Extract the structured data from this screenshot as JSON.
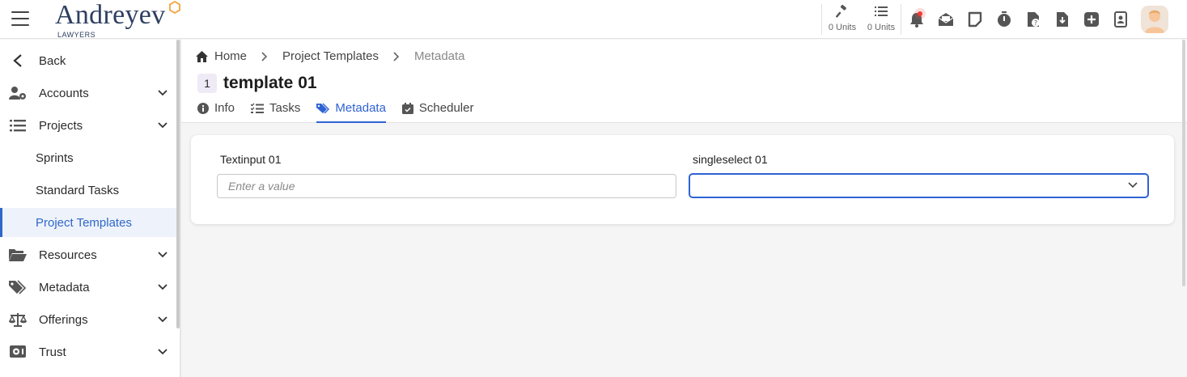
{
  "brand": {
    "name": "Andreyev",
    "tagline": "LAWYERS",
    "accent": "#f4a23a"
  },
  "topbar": {
    "units": [
      {
        "icon": "gavel-icon",
        "label": "0 Units"
      },
      {
        "icon": "list-icon",
        "label": "0 Units"
      }
    ],
    "icons": [
      "bell-icon",
      "mail-open-icon",
      "sticky-note-icon",
      "stopwatch-icon",
      "file-question-icon",
      "file-download-icon",
      "plus-square-icon",
      "contact-card-icon",
      "user-avatar"
    ]
  },
  "sidebar": {
    "items": [
      {
        "label": "Back",
        "icon": "chevron-left-icon",
        "expandable": false
      },
      {
        "label": "Accounts",
        "icon": "user-gear-icon",
        "expandable": true
      },
      {
        "label": "Projects",
        "icon": "list-icon",
        "expandable": true
      },
      {
        "label": "Sprints",
        "sub": true
      },
      {
        "label": "Standard Tasks",
        "sub": true
      },
      {
        "label": "Project Templates",
        "sub": true,
        "active": true
      },
      {
        "label": "Resources",
        "icon": "folder-open-icon",
        "expandable": true
      },
      {
        "label": "Metadata",
        "icon": "tags-icon",
        "expandable": true
      },
      {
        "label": "Offerings",
        "icon": "scale-icon",
        "expandable": true
      },
      {
        "label": "Trust",
        "icon": "vault-icon",
        "expandable": true
      }
    ]
  },
  "breadcrumb": {
    "home": "Home",
    "section": "Project Templates",
    "current": "Metadata"
  },
  "page": {
    "badge": "1",
    "title": "template 01"
  },
  "tabs": [
    {
      "label": "Info",
      "icon": "info-circle-icon"
    },
    {
      "label": "Tasks",
      "icon": "task-list-icon"
    },
    {
      "label": "Metadata",
      "icon": "tags-icon",
      "active": true
    },
    {
      "label": "Scheduler",
      "icon": "calendar-check-icon"
    }
  ],
  "form": {
    "text_label": "Textinput 01",
    "text_placeholder": "Enter a value",
    "text_value": "",
    "select_label": "singleselect 01",
    "select_value": ""
  },
  "colors": {
    "primary": "#2f63d3",
    "brand_navy": "#2f3f61",
    "notification": "#ef3b36"
  }
}
